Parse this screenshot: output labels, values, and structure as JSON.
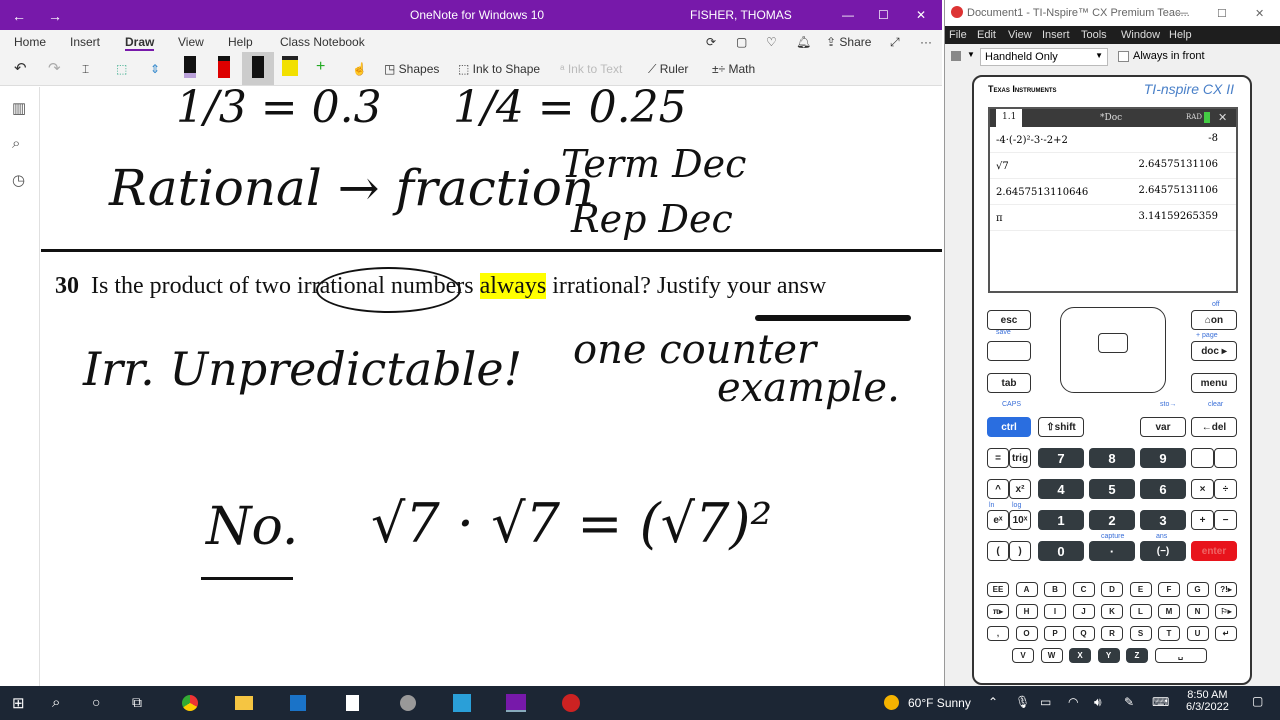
{
  "onenote": {
    "title": "OneNote for Windows 10",
    "user": "FISHER, THOMAS",
    "tabs": [
      "Home",
      "Insert",
      "Draw",
      "View",
      "Help",
      "Class Notebook"
    ],
    "active_tab": "Draw",
    "toolbar": {
      "shapes": "Shapes",
      "ink_to_shape": "Ink to Shape",
      "ink_to_text": "Ink to Text",
      "ruler": "Ruler",
      "math": "Math",
      "share": "Share"
    },
    "question_number": "30",
    "question_pre": "Is the product of two irrational numbers ",
    "question_highlight": "always",
    "question_post": " irrational? Justify your answ",
    "handwriting": {
      "a": "1/3 = 0.3",
      "b": "1/4 = 0.25",
      "c": "Rational → fraction",
      "d": "Term Dec",
      "e": "Rep Dec",
      "f": "Irr. Unpredictable!",
      "g": "one counter",
      "h": "example.",
      "i": "No.",
      "j": "√7 · √7 = (√7)²"
    }
  },
  "ti": {
    "title": "Document1 - TI-Nspire™ CX Premium Teac...",
    "menu": [
      "File",
      "Edit",
      "View",
      "Insert",
      "Tools",
      "Window",
      "Help"
    ],
    "view_select": "Handheld Only",
    "always_in_front": "Always in front",
    "brand": "Texas Instruments",
    "model": "TI-nspire CX II",
    "screen": {
      "tab": "1.1",
      "doc": "*Doc",
      "mode": "RAD",
      "history": [
        {
          "in": "-4·(-2)²-3·-2+2",
          "out": "-8"
        },
        {
          "in": "√7",
          "out": "2.64575131106"
        },
        {
          "in": "2.6457513110646",
          "out": "2.64575131106"
        },
        {
          "in": "π",
          "out": "3.14159265359"
        }
      ]
    },
    "keys": {
      "esc": "esc",
      "on": "⌂on",
      "doc": "doc ▸",
      "tab": "tab",
      "menu": "menu",
      "ctrl": "ctrl",
      "shift": "⇧shift",
      "var": "var",
      "del": "←del",
      "eq": "=",
      "trig": "trig",
      "caret": "^",
      "x2": "x²",
      "ex": "eˣ",
      "tenx": "10ˣ",
      "lp": "(",
      "rp": ")",
      "times": "×",
      "div": "÷",
      "plus": "+",
      "minus": "−",
      "neg": "(−)",
      "dot": "·",
      "enter": "enter",
      "digits": [
        "7",
        "8",
        "9",
        "4",
        "5",
        "6",
        "1",
        "2",
        "3",
        "0"
      ],
      "alpha": [
        [
          "EE",
          "A",
          "B",
          "C",
          "D",
          "E",
          "F",
          "G",
          "?!▸"
        ],
        [
          "π▸",
          "H",
          "I",
          "J",
          "K",
          "L",
          "M",
          "N",
          "⚐▸"
        ],
        [
          ",",
          "O",
          "P",
          "Q",
          "R",
          "S",
          "T",
          "U",
          "↵"
        ],
        [
          "V",
          "W",
          "X",
          "Y",
          "Z",
          "␣"
        ]
      ],
      "sub": {
        "save": "save",
        "off": "off",
        "page": "+ page",
        "caps": "CAPS",
        "sto": "sto→",
        "clear": "clear",
        "capture": "capture",
        "ans": "ans",
        "ln": "ln",
        "log": "log"
      }
    },
    "ctrl_color": "#2a6ee0",
    "enter_color": "#e8141c"
  },
  "taskbar": {
    "weather": "60°F  Sunny",
    "time": "8:50 AM",
    "date": "6/3/2022"
  }
}
